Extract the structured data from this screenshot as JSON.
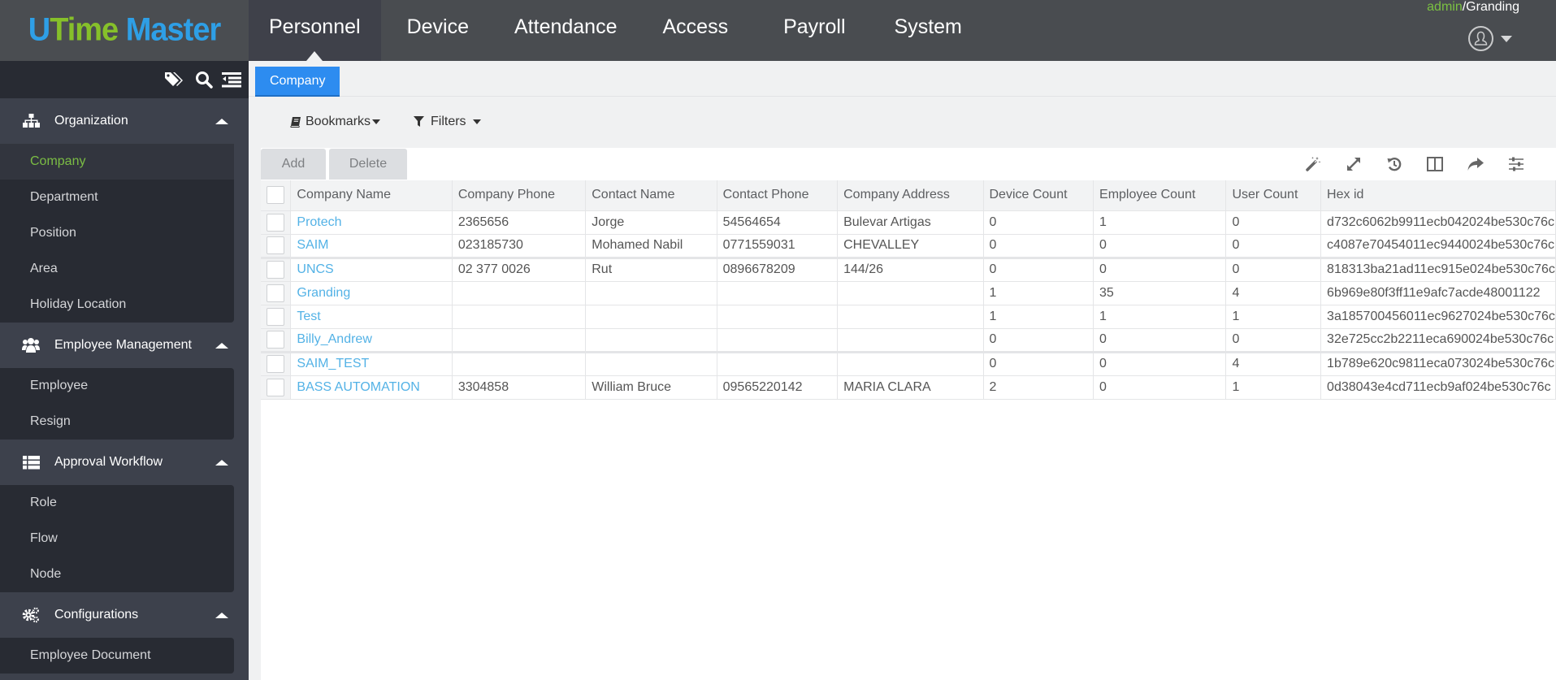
{
  "app": {
    "logo": {
      "part1": "U",
      "part2": "Time",
      "part3": " Master"
    },
    "colors": {
      "accent": "#2d8cf0",
      "link": "#53b2e6",
      "active_green": "#7bbd44",
      "logo_blue": "#2e9fe6",
      "logo_green": "#86c02a"
    }
  },
  "header": {
    "nav": [
      {
        "label": "Personnel",
        "active": true
      },
      {
        "label": "Device"
      },
      {
        "label": "Attendance"
      },
      {
        "label": "Access"
      },
      {
        "label": "Payroll"
      },
      {
        "label": "System"
      }
    ],
    "user": {
      "name": "admin",
      "separator": "/",
      "company": "Granding"
    },
    "icons": {
      "avatar": "user-circle-icon",
      "caret": "caret-down-icon"
    }
  },
  "sidebar": {
    "tools": [
      "tags-icon",
      "search-icon",
      "collapse-menu-icon"
    ],
    "groups": [
      {
        "label": "Organization",
        "icon": "sitemap-icon",
        "items": [
          {
            "label": "Company",
            "active": true
          },
          {
            "label": "Department"
          },
          {
            "label": "Position"
          },
          {
            "label": "Area"
          },
          {
            "label": "Holiday Location"
          }
        ]
      },
      {
        "label": "Employee Management",
        "icon": "users-icon",
        "items": [
          {
            "label": "Employee"
          },
          {
            "label": "Resign"
          }
        ]
      },
      {
        "label": "Approval Workflow",
        "icon": "list-icon",
        "items": [
          {
            "label": "Role"
          },
          {
            "label": "Flow"
          },
          {
            "label": "Node"
          }
        ]
      },
      {
        "label": "Configurations",
        "icon": "gears-icon",
        "items": [
          {
            "label": "Employee Document"
          }
        ]
      }
    ]
  },
  "content": {
    "tab": "Company",
    "bookmarks_label": "Bookmarks",
    "filters_label": "Filters",
    "toolbar": {
      "add_label": "Add",
      "delete_label": "Delete",
      "icons": [
        "magic-wand-icon",
        "expand-icon",
        "history-icon",
        "columns-icon",
        "share-icon",
        "sliders-icon"
      ]
    },
    "table": {
      "columns": [
        "Company Name",
        "Company Phone",
        "Contact Name",
        "Contact Phone",
        "Company Address",
        "Device Count",
        "Employee Count",
        "User Count",
        "Hex id"
      ],
      "rows": [
        [
          "Protech",
          "2365656",
          "Jorge",
          "54564654",
          "Bulevar Artigas",
          "0",
          "1",
          "0",
          "d732c6062b9911ecb042024be530c76c"
        ],
        [
          "SAIM",
          "023185730",
          "Mohamed Nabil",
          "0771559031",
          "CHEVALLEY",
          "0",
          "0",
          "0",
          "c4087e70454011ec9440024be530c76c"
        ],
        [
          "UNCS",
          "02 377 0026",
          "Rut",
          "0896678209",
          "144/26",
          "0",
          "0",
          "0",
          "818313ba21ad11ec915e024be530c76c"
        ],
        [
          "Granding",
          "",
          "",
          "",
          "",
          "1",
          "35",
          "4",
          "6b969e80f3ff11e9afc7acde48001122"
        ],
        [
          "Test",
          "",
          "",
          "",
          "",
          "1",
          "1",
          "1",
          "3a185700456011ec9627024be530c76c"
        ],
        [
          "Billy_Andrew",
          "",
          "",
          "",
          "",
          "0",
          "0",
          "0",
          "32e725cc2b2211eca690024be530c76c"
        ],
        [
          "SAIM_TEST",
          "",
          "",
          "",
          "",
          "0",
          "0",
          "4",
          "1b789e620c9811eca073024be530c76c"
        ],
        [
          "BASS AUTOMATION",
          "3304858",
          "William Bruce",
          "09565220142",
          "MARIA CLARA",
          "2",
          "0",
          "1",
          "0d38043e4cd711ecb9af024be530c76c"
        ]
      ]
    }
  }
}
